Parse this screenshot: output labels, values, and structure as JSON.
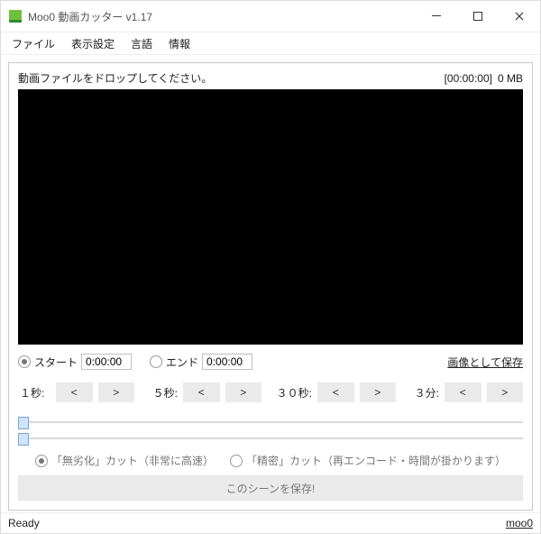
{
  "window": {
    "title": "Moo0 動画カッター v1.17"
  },
  "menu": {
    "file": "ファイル",
    "view": "表示設定",
    "lang": "言語",
    "info": "情報"
  },
  "video": {
    "hint": "動画ファイルをドロップしてください。",
    "timecode": "[00:00:00]",
    "size": "0 MB"
  },
  "time": {
    "start_label": "スタート",
    "start_value": "0:00:00",
    "end_label": "エンド",
    "end_value": "0:00:00",
    "save_image": "画像として保存"
  },
  "nudge": {
    "s1": "１秒:",
    "s5": "５秒:",
    "s30": "３０秒:",
    "m3": "３分:",
    "lt": "<",
    "gt": ">"
  },
  "mode": {
    "lossless": "「無劣化」カット（非常に高速）",
    "precise": "「精密」カット（再エンコード・時間が掛かります）"
  },
  "save_button": "このシーンを保存!",
  "status": {
    "left": "Ready",
    "right": "moo0"
  }
}
